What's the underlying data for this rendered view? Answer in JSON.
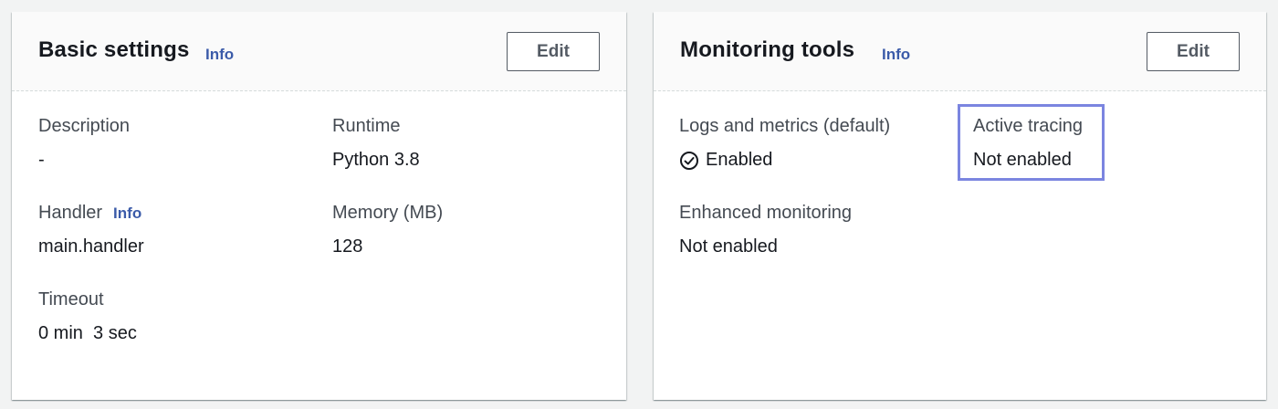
{
  "basic_settings": {
    "title": "Basic settings",
    "info_label": "Info",
    "edit_label": "Edit",
    "fields": {
      "description": {
        "label": "Description",
        "value": "-"
      },
      "runtime": {
        "label": "Runtime",
        "value": "Python 3.8"
      },
      "handler": {
        "label": "Handler",
        "info_label": "Info",
        "value": "main.handler"
      },
      "memory": {
        "label": "Memory (MB)",
        "value": "128"
      },
      "timeout": {
        "label": "Timeout",
        "value": "0 min  3 sec"
      }
    }
  },
  "monitoring_tools": {
    "title": "Monitoring tools",
    "info_label": "Info",
    "edit_label": "Edit",
    "fields": {
      "logs_metrics": {
        "label": "Logs and metrics (default)",
        "value": "Enabled",
        "icon": "check-circle-icon"
      },
      "active_tracing": {
        "label": "Active tracing",
        "value": "Not enabled",
        "highlighted": true
      },
      "enhanced_monitoring": {
        "label": "Enhanced monitoring",
        "value": "Not enabled"
      }
    }
  },
  "colors": {
    "info_link": "#3b5ba9",
    "highlight": "#7b85e0",
    "page_background": "#f2f3f3"
  }
}
